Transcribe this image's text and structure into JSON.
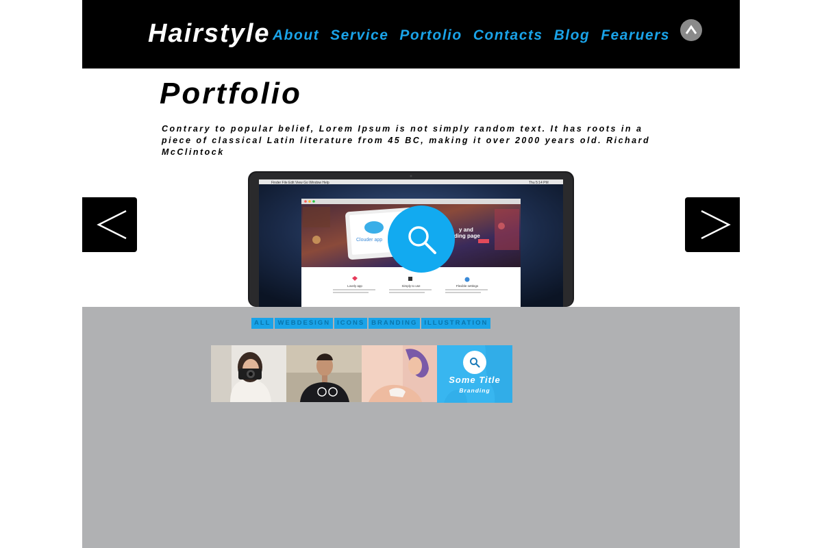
{
  "header": {
    "logo": "Hairstyle",
    "nav": [
      "About",
      "Service",
      "Portolio",
      "Contacts",
      "Blog",
      "Fearuers"
    ]
  },
  "hero": {
    "title": "Portfolio",
    "intro": "Contrary to popular belief, Lorem Ipsum is not simply random text. It has roots in a piece of classical Latin literature from 45 BC, making it over 2000 years old. Richard McClintock"
  },
  "laptop_screen": {
    "card_label": "Clouder app",
    "overlay_text_1": "y and",
    "overlay_text_2": "nding page",
    "features": [
      "Lovely app",
      "Simply to use",
      "Flexible settings"
    ]
  },
  "filters": [
    "ALL",
    "WEBDESIGN",
    "ICONS",
    "BRANDING",
    "ILLUSTRATION"
  ],
  "gallery": {
    "overlay_title": "Some Title",
    "overlay_sub": "Branding"
  },
  "colors": {
    "accent": "#1aa3e8",
    "header_bg": "#000000",
    "gallery_bg": "#b0b1b3"
  }
}
